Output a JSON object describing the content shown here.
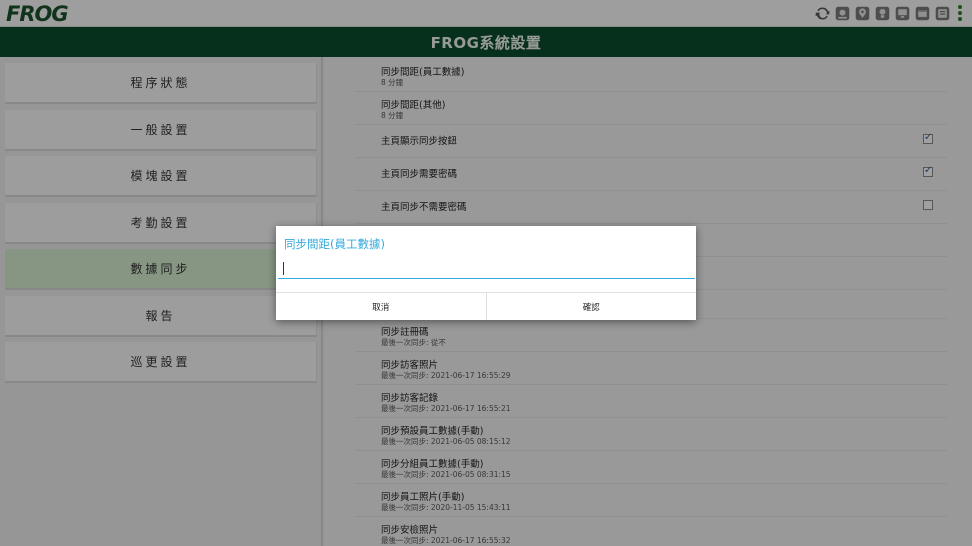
{
  "app": {
    "logo_text": "FROG",
    "title": "FROG系統設置"
  },
  "top_icons": [
    "sync-icon",
    "device-icon",
    "location-icon",
    "bulb-icon",
    "monitor-icon",
    "calendar-icon",
    "id-card-icon",
    "overflow-menu-icon"
  ],
  "menu": {
    "items": [
      {
        "label": "程序狀態",
        "active": false
      },
      {
        "label": "一般設置",
        "active": false
      },
      {
        "label": "模塊設置",
        "active": false
      },
      {
        "label": "考勤設置",
        "active": false
      },
      {
        "label": "數據同步",
        "active": true
      },
      {
        "label": "報告",
        "active": false
      },
      {
        "label": "巡更設置",
        "active": false
      }
    ]
  },
  "settings": {
    "rows": [
      {
        "title": "同步間距(員工數據)",
        "subtitle": "8 分鐘"
      },
      {
        "title": "同步間距(其他)",
        "subtitle": "8 分鐘"
      },
      {
        "title": "主頁顯示同步按鈕",
        "checked": true
      },
      {
        "title": "主頁同步需要密碼",
        "checked": true
      },
      {
        "title": "主頁同步不需要密碼",
        "checked": false
      },
      {
        "title": "同步註冊碼",
        "subtitle": "最後一次同步: 從不"
      },
      {
        "title": "同步訪客照片",
        "subtitle": "最後一次同步: 2021-06-17 16:55:29"
      },
      {
        "title": "同步訪客記錄",
        "subtitle": "最後一次同步: 2021-06-17 16:55:21"
      },
      {
        "title": "同步預設員工數據(手動)",
        "subtitle": "最後一次同步: 2021-06-05 08:15:12"
      },
      {
        "title": "同步分組員工數據(手動)",
        "subtitle": "最後一次同步: 2021-06-05 08:31:15"
      },
      {
        "title": "同步員工照片(手動)",
        "subtitle": "最後一次同步: 2020-11-05 15:43:11"
      },
      {
        "title": "同步安檢照片",
        "subtitle": "最後一次同步: 2021-06-17 16:55:32"
      }
    ]
  },
  "dialog": {
    "title": "同步間距(員工數據)",
    "input_value": "",
    "cancel_label": "取消",
    "confirm_label": "確認"
  },
  "colors": {
    "title_bar": "#0b4a2b",
    "dialog_accent": "#33aadd",
    "active_menu": "#cfe6c9"
  }
}
